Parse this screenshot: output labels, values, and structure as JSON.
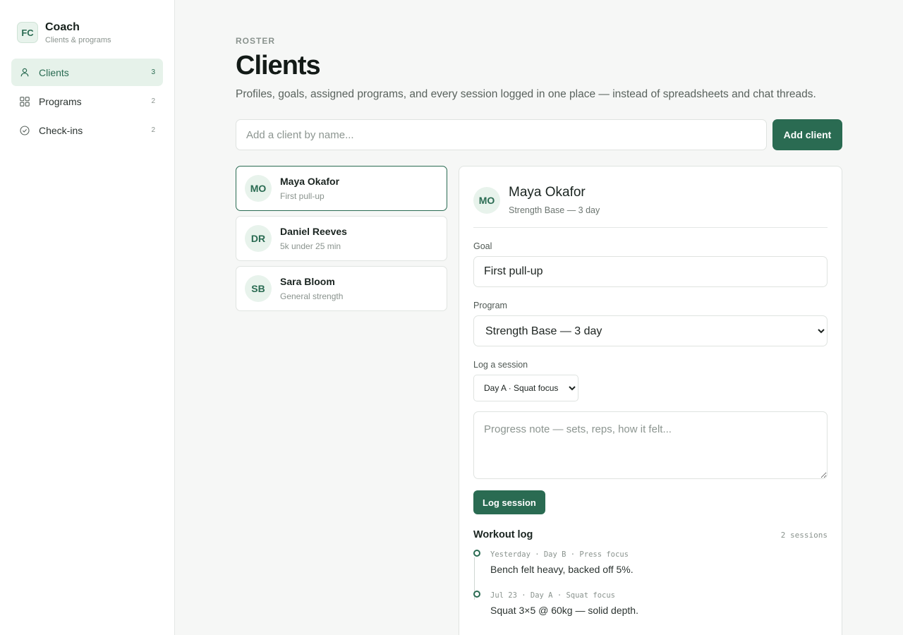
{
  "brand": {
    "initials": "FC",
    "title": "Coach",
    "subtitle": "Clients & programs"
  },
  "nav": [
    {
      "label": "Clients",
      "count": "3",
      "icon": "user-icon",
      "active": true
    },
    {
      "label": "Programs",
      "count": "2",
      "icon": "grid-icon",
      "active": false
    },
    {
      "label": "Check-ins",
      "count": "2",
      "icon": "check-circle-icon",
      "active": false
    }
  ],
  "header": {
    "eyebrow": "ROSTER",
    "title": "Clients",
    "subtitle": "Profiles, goals, assigned programs, and every session logged in one place — instead of spreadsheets and chat threads."
  },
  "add_client": {
    "placeholder": "Add a client by name...",
    "button": "Add client"
  },
  "clients": [
    {
      "initials": "MO",
      "name": "Maya Okafor",
      "goal": "First pull-up"
    },
    {
      "initials": "DR",
      "name": "Daniel Reeves",
      "goal": "5k under 25 min"
    },
    {
      "initials": "SB",
      "name": "Sara Bloom",
      "goal": "General strength"
    }
  ],
  "detail": {
    "initials": "MO",
    "name": "Maya Okafor",
    "program_summary": "Strength Base — 3 day",
    "goal_label": "Goal",
    "goal_value": "First pull-up",
    "program_label": "Program",
    "program_value": "Strength Base — 3 day",
    "session_label": "Log a session",
    "session_value": "Day A · Squat focus",
    "note_placeholder": "Progress note — sets, reps, how it felt...",
    "log_button": "Log session",
    "log_title": "Workout log",
    "log_count": "2 sessions",
    "log": [
      {
        "meta": "Yesterday · Day B · Press focus",
        "text": "Bench felt heavy, backed off 5%."
      },
      {
        "meta": "Jul 23 · Day A · Squat focus",
        "text": "Squat 3×5 @ 60kg — solid depth."
      }
    ]
  },
  "colors": {
    "accent": "#2a6b52",
    "accent_soft": "#e6f2ea",
    "background": "#f6f7f6"
  }
}
